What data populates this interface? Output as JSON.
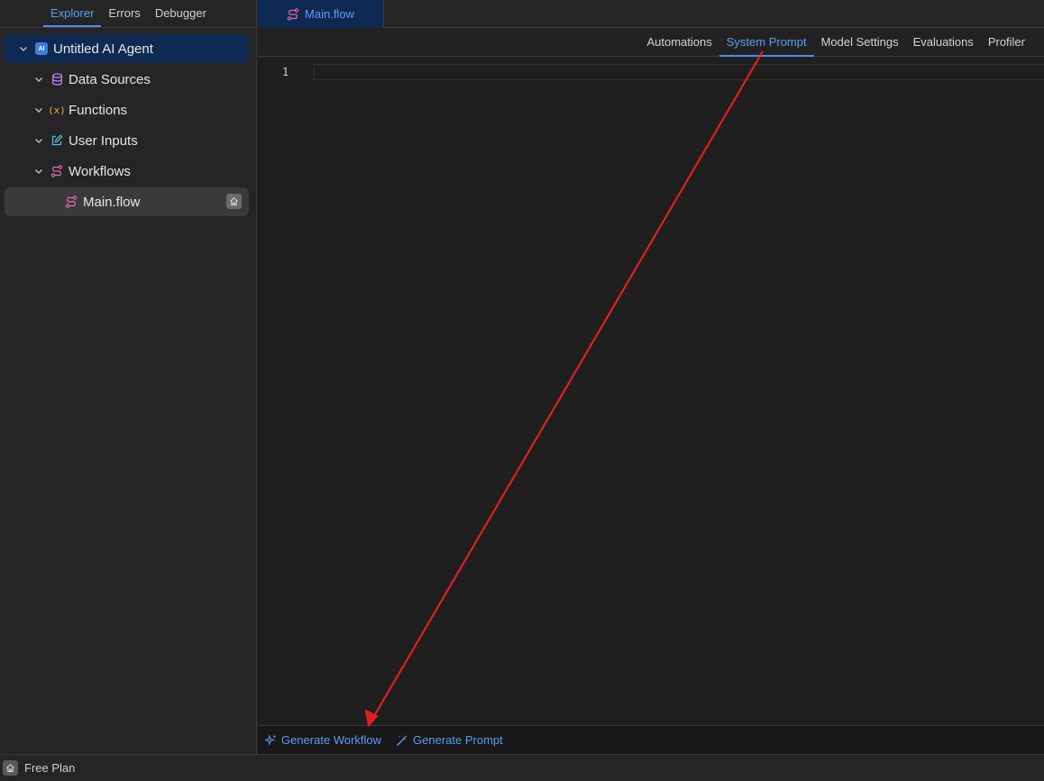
{
  "sidebar": {
    "tabs": [
      {
        "label": "Explorer"
      },
      {
        "label": "Errors"
      },
      {
        "label": "Debugger"
      }
    ],
    "tree": {
      "root": {
        "label": "Untitled AI Agent",
        "icon": "ai-agent-icon",
        "badge": "AI"
      },
      "items": [
        {
          "label": "Data Sources",
          "icon": "database-icon"
        },
        {
          "label": "Functions",
          "icon": "function-icon"
        },
        {
          "label": "User Inputs",
          "icon": "edit-icon"
        },
        {
          "label": "Workflows",
          "icon": "workflow-icon"
        }
      ],
      "file": {
        "label": "Main.flow",
        "icon": "workflow-icon"
      }
    }
  },
  "editor_tabs": {
    "open_file": "Main.flow"
  },
  "sub_tabs": [
    {
      "label": "Automations"
    },
    {
      "label": "System Prompt"
    },
    {
      "label": "Model Settings"
    },
    {
      "label": "Evaluations"
    },
    {
      "label": "Profiler"
    }
  ],
  "editor": {
    "line_number": "1",
    "content": ""
  },
  "bottom_bar": {
    "generate_workflow": "Generate Workflow",
    "generate_prompt": "Generate Prompt"
  },
  "status_bar": {
    "plan": "Free Plan"
  },
  "colors": {
    "accent": "#5b9cf6",
    "workflow_icon": "#e06c9f",
    "database_icon": "#b48ef0",
    "function_icon": "#e5a94a",
    "edit_icon": "#5fb8e6",
    "annotation_arrow": "#e02020"
  }
}
